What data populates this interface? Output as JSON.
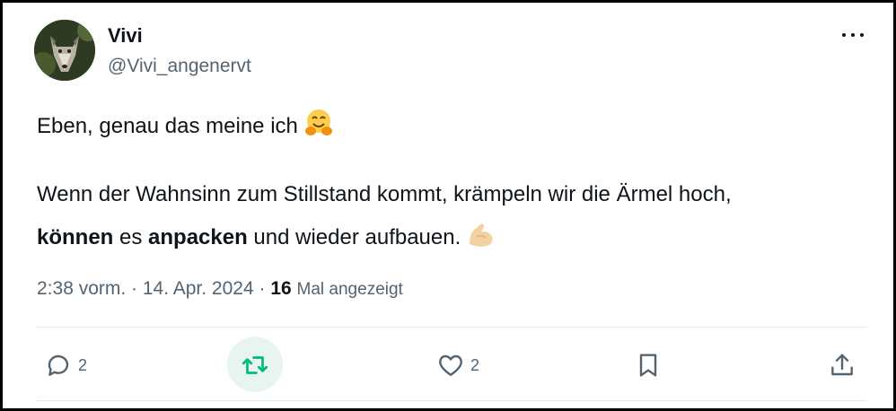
{
  "tweet": {
    "author_name": "Vivi",
    "author_handle": "@Vivi_angenervt",
    "line1": "Eben, genau das meine ich",
    "line1_emoji": "hugging-face",
    "line2": "Wenn der Wahnsinn zum Stillstand kommt, krämpeln wir die Ärmel hoch,",
    "line3_bold1": "können",
    "line3_part2": " es ",
    "line3_bold2": "anpacken",
    "line3_part3": " und wieder aufbauen.",
    "line3_emoji": "flexed-biceps",
    "time": "2:38 vorm. · 14. Apr. 2024 ·",
    "views_count": "16",
    "views_label": "Mal angezeigt"
  },
  "actions": {
    "reply_count": "2",
    "like_count": "2",
    "icons": [
      "reply-icon",
      "retweet-icon",
      "like-icon",
      "bookmark-icon",
      "share-icon"
    ],
    "retweet_color": "#00ba7c"
  }
}
